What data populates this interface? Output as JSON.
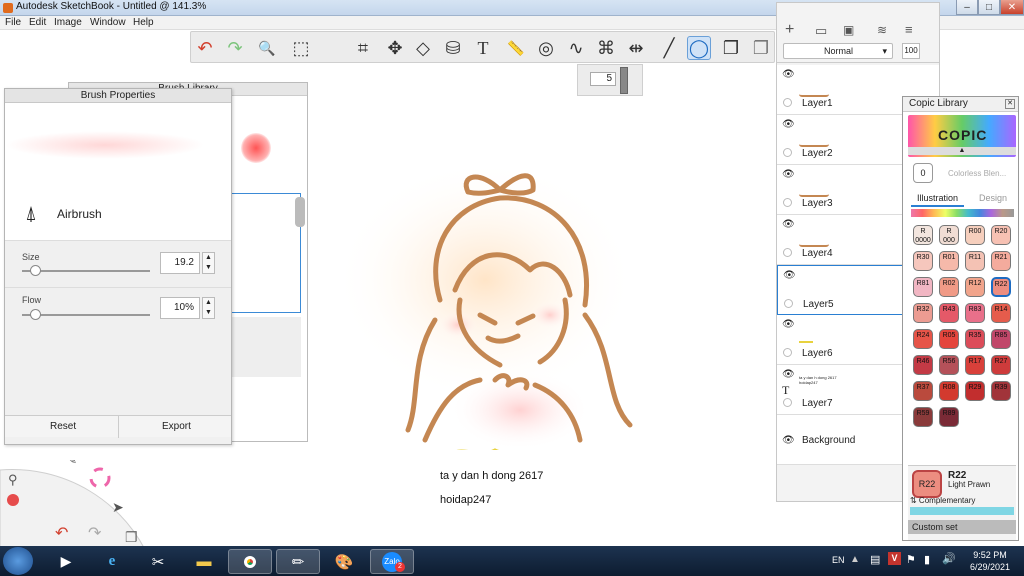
{
  "window": {
    "title": "Autodesk SketchBook - Untitled @ 141.3%",
    "btn_min": "–",
    "btn_max": "□",
    "btn_close": "✕"
  },
  "menu": [
    "File",
    "Edit",
    "Image",
    "Window",
    "Help"
  ],
  "toolbar": {
    "undo": "↶",
    "redo": "↷",
    "zoom": "🔍",
    "select": "⬚",
    "crop": "⌗",
    "transform": "✥",
    "distort": "◇",
    "fill": "⛁",
    "text": "T",
    "ruler": "📏",
    "ellipse": "◎",
    "curve": "∿",
    "perspective": "⌘",
    "symmetry": "⇹",
    "stroke": "╱",
    "lasso": "◯",
    "shapes": "❐"
  },
  "size_popup": {
    "value": "5"
  },
  "brush_library": {
    "title": "Brush Library"
  },
  "brush_props": {
    "title": "Brush Properties",
    "brush_name": "Airbrush",
    "size_label": "Size",
    "size_value": "19.2",
    "size_fraction": 0.1,
    "flow_label": "Flow",
    "flow_value": "10%",
    "flow_fraction": 0.1,
    "reset": "Reset",
    "export": "Export"
  },
  "canvas": {
    "caption1": "ta y dan h dong 2617",
    "caption2": "hoidap247"
  },
  "layers": {
    "blend_mode": "Normal",
    "opacity": "100",
    "items": [
      {
        "name": "Layer1"
      },
      {
        "name": "Layer2"
      },
      {
        "name": "Layer3"
      },
      {
        "name": "Layer4"
      },
      {
        "name": "Layer5"
      },
      {
        "name": "Layer6"
      },
      {
        "name": "Layer7"
      },
      {
        "name": "Background"
      }
    ],
    "text_layer_preview": "ta y dan h dong 2617 hoidap247"
  },
  "copic": {
    "title": "Copic Library",
    "colorless": "Colorless Blen...",
    "colorless_code": "0",
    "tab_illustration": "Illustration",
    "tab_design": "Design",
    "swatches": [
      {
        "code": "R 0000",
        "color": "#f3e6df"
      },
      {
        "code": "R 000",
        "color": "#f1ddd4"
      },
      {
        "code": "R00",
        "color": "#f6cfbd"
      },
      {
        "code": "R20",
        "color": "#f7c1b3"
      },
      {
        "code": "R30",
        "color": "#f6c7bd"
      },
      {
        "code": "R01",
        "color": "#f6b9aa"
      },
      {
        "code": "R11",
        "color": "#f4c2b4"
      },
      {
        "code": "R21",
        "color": "#f4ab9d"
      },
      {
        "code": "R81",
        "color": "#f1b6c3"
      },
      {
        "code": "R02",
        "color": "#f09a86"
      },
      {
        "code": "R12",
        "color": "#f1a48b"
      },
      {
        "code": "R22",
        "color": "#ec8d80"
      },
      {
        "code": "R32",
        "color": "#ec9c92"
      },
      {
        "code": "R43",
        "color": "#e55968"
      },
      {
        "code": "R83",
        "color": "#e9708a"
      },
      {
        "code": "R14",
        "color": "#e55c4c"
      },
      {
        "code": "R24",
        "color": "#e65448"
      },
      {
        "code": "R05",
        "color": "#e4453c"
      },
      {
        "code": "R35",
        "color": "#dc4c59"
      },
      {
        "code": "R85",
        "color": "#c1476a"
      },
      {
        "code": "R46",
        "color": "#c33a45"
      },
      {
        "code": "R56",
        "color": "#b55159"
      },
      {
        "code": "R17",
        "color": "#d9403a"
      },
      {
        "code": "R27",
        "color": "#ce3b3b"
      },
      {
        "code": "R37",
        "color": "#ba4a3d"
      },
      {
        "code": "R08",
        "color": "#d33a2e"
      },
      {
        "code": "R29",
        "color": "#c22e2e"
      },
      {
        "code": "R39",
        "color": "#a1343a"
      },
      {
        "code": "R59",
        "color": "#8a3a3a"
      },
      {
        "code": "R89",
        "color": "#7a2a36"
      }
    ],
    "selected_code": "R22",
    "selected_name": "Light Prawn",
    "complementary": "⇅ Complementary",
    "custom_set": "Custom set"
  },
  "taskbar": {
    "lang": "EN",
    "time": "9:52 PM",
    "date": "6/29/2021",
    "zalo": "Zalo",
    "zalo_badge": "2"
  }
}
